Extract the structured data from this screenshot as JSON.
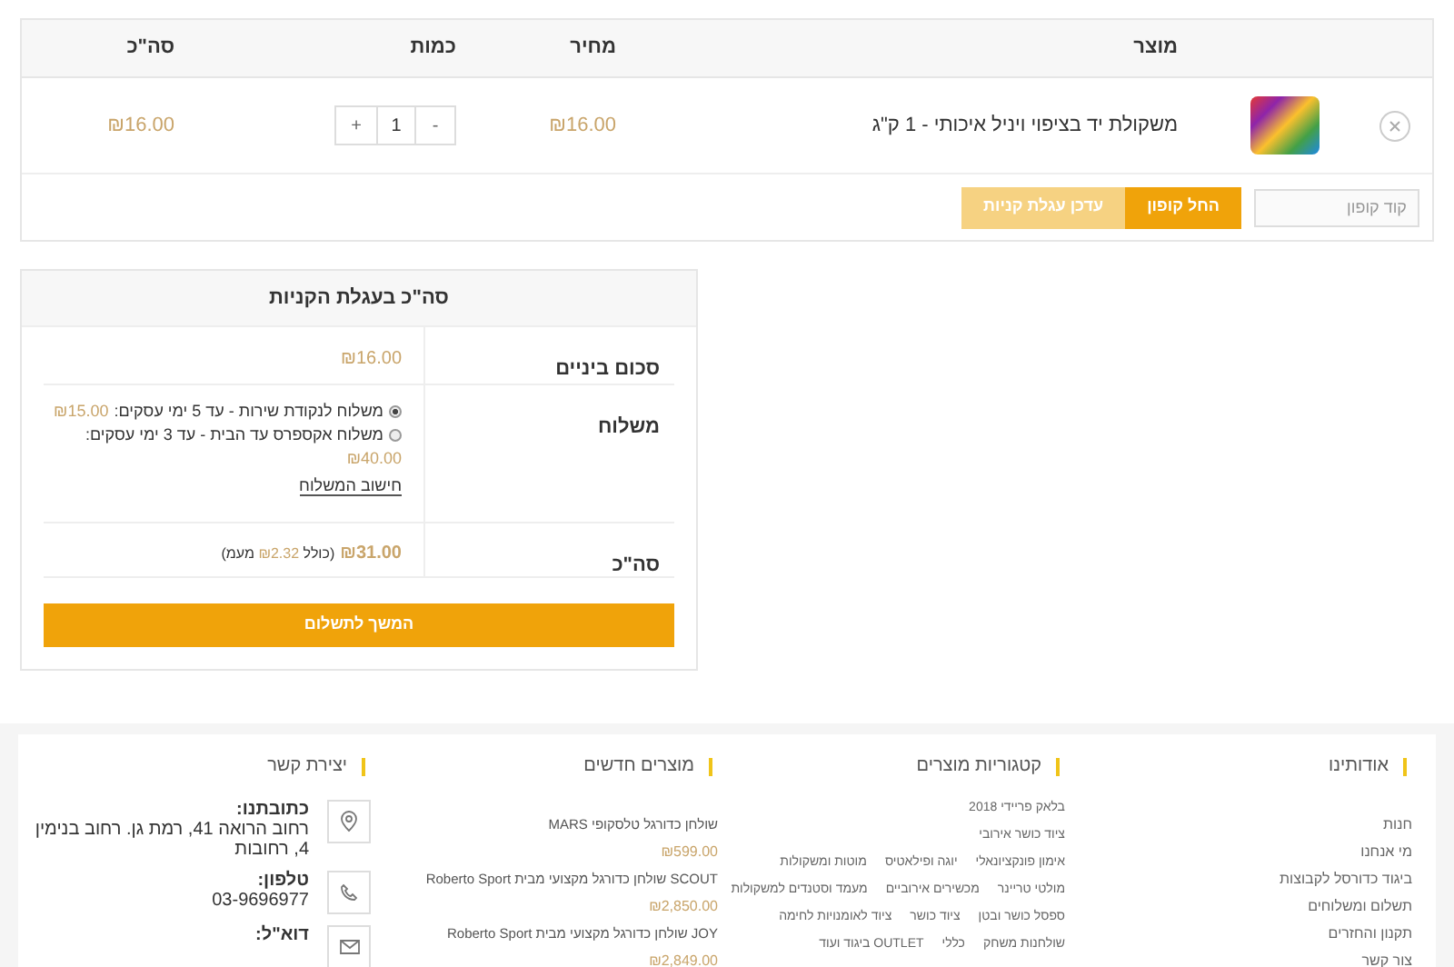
{
  "cart": {
    "columns": [
      "מוצר",
      "מחיר",
      "כמות",
      "סה\"כ"
    ],
    "items": [
      {
        "name": "משקולת יד בציפוי ויניל איכותי - 1 ק\"ג",
        "price": "₪16.00",
        "quantity": "1",
        "minus": "-",
        "plus": "+",
        "total": "₪16.00"
      }
    ],
    "coupon": {
      "placeholder": "קוד קופון",
      "apply": "החל קופון",
      "update": "עדכן עגלת קניות",
      "update_disabled": true
    }
  },
  "totals": {
    "title": "סה\"כ בעגלת הקניות",
    "subtotal_label": "סכום ביניים",
    "subtotal": "₪16.00",
    "shipping_label": "משלוח",
    "shipping_options": [
      {
        "label": "משלוח לנקודת שירות - עד 5 ימי עסקים:",
        "price": "₪15.00",
        "selected": true
      },
      {
        "label": "משלוח אקספרס עד הבית - עד 3 ימי עסקים:",
        "price": "₪40.00",
        "selected": false
      }
    ],
    "calculate_link": "חישוב המשלוח",
    "total_label": "סה\"כ",
    "total": "₪31.00",
    "tax_before": "(כולל",
    "tax": "₪2.32",
    "tax_after": "מעמ)",
    "checkout": "המשך לתשלום"
  },
  "footer": {
    "about": {
      "title": "אודותינו",
      "links": [
        "חנות",
        "מי אנחנו",
        "ביגוד כדורסל לקבוצות",
        "תשלום ומשלוחים",
        "תקנון והחזרים",
        "צור קשר"
      ]
    },
    "categories": {
      "title": "קטגוריות מוצרים",
      "rows": [
        [
          "בלאק פריידי 2018"
        ],
        [
          "ציוד כושר אירובי"
        ],
        [
          "אימון פונקציונאלי",
          "יוגה ופילאטיס",
          "מוטות ומשקולות"
        ],
        [
          "מולטי טריינר",
          "מכשירים אירוביים",
          "מעמד וסטנדים למשקולות"
        ],
        [
          "ספסל כושר ובטן",
          "ציוד כושר",
          "ציוד לאומנויות לחימה"
        ],
        [
          "שולחנות משחק",
          "כללי",
          "OUTLET ביגוד ועוד"
        ]
      ]
    },
    "new_products": {
      "title": "מוצרים חדשים",
      "items": [
        {
          "name": "שולחן כדורגל טלסקופי MARS",
          "price": "₪599.00"
        },
        {
          "name": "SCOUT שולחן כדורגל מקצועי מבית Roberto Sport",
          "price": "₪2,850.00"
        },
        {
          "name": "JOY שולחן כדורגל מקצועי מבית Roberto Sport",
          "price": "₪2,849.00"
        }
      ]
    },
    "contact": {
      "title": "יצירת קשר",
      "items": [
        {
          "kind": "address",
          "label": "כתובתנו:",
          "value": "רחוב הרואה 41, רמת גן. רחוב בנימין 4, רחובות"
        },
        {
          "kind": "phone",
          "label": "טלפון:",
          "value": "03-9696977"
        },
        {
          "kind": "email",
          "label": "דוא\"ל:",
          "value": ""
        }
      ]
    }
  }
}
